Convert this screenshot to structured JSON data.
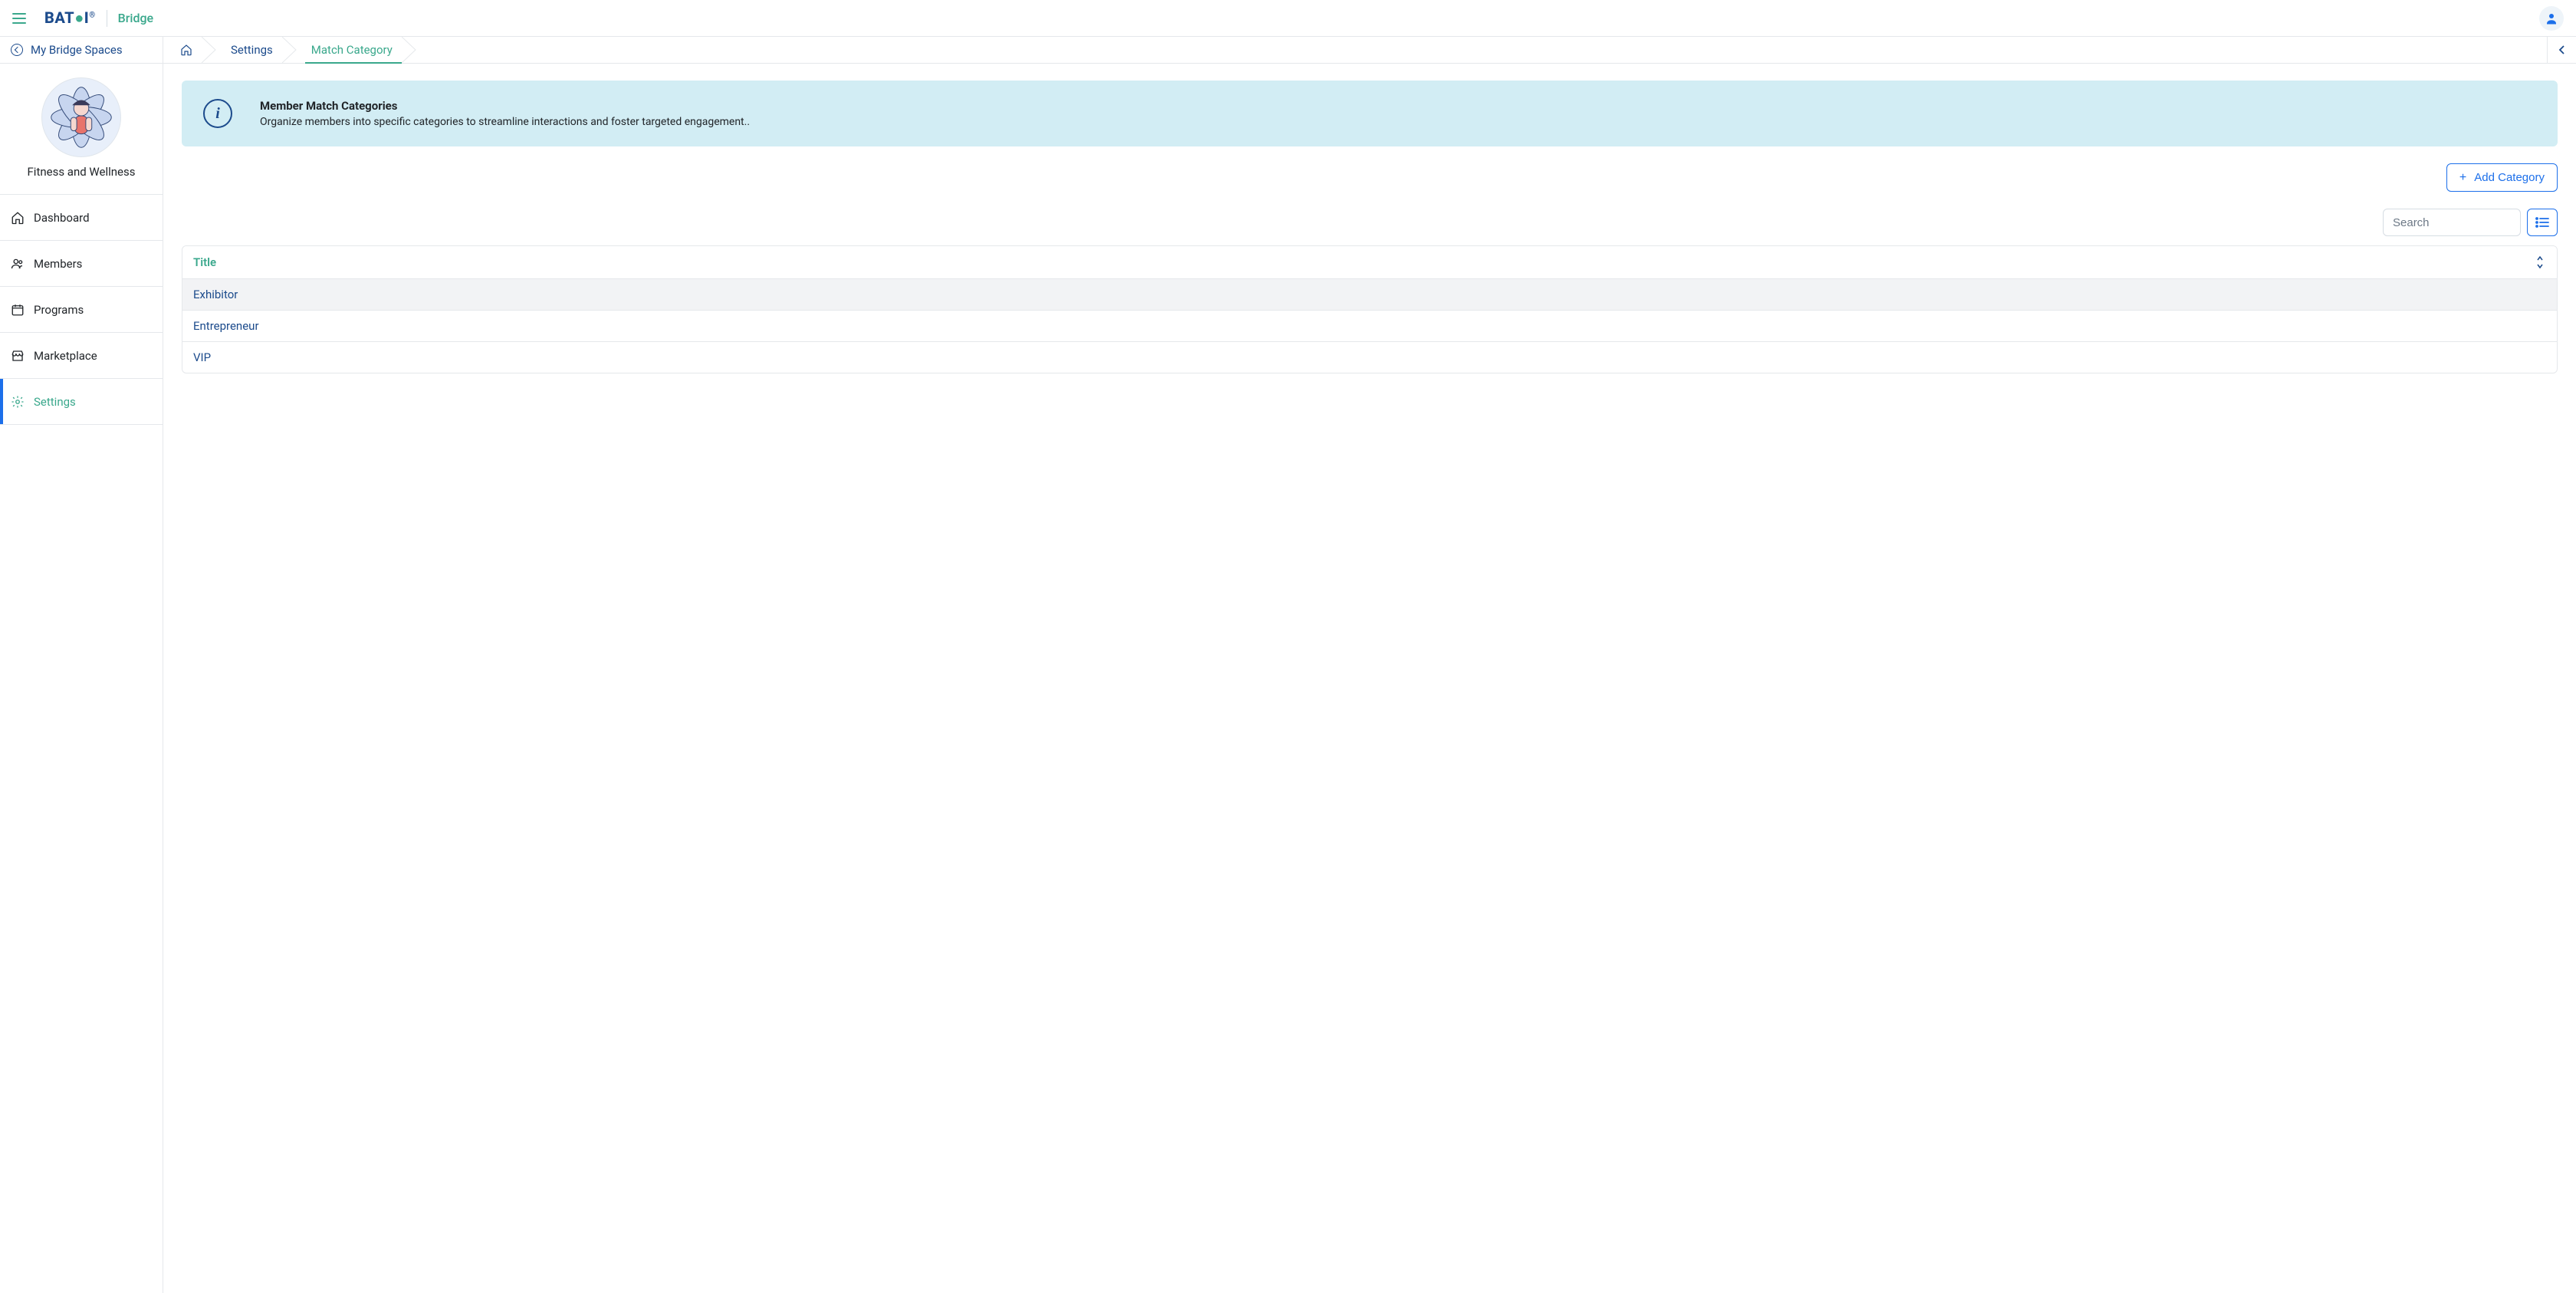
{
  "brand": {
    "logo_text_pre": "BAT",
    "logo_text_post": "I",
    "product": "Bridge"
  },
  "sidebar": {
    "back_label": "My Bridge Spaces",
    "workspace_name": "Fitness and Wellness",
    "items": [
      {
        "label": "Dashboard",
        "icon": "home-icon"
      },
      {
        "label": "Members",
        "icon": "members-icon"
      },
      {
        "label": "Programs",
        "icon": "calendar-icon"
      },
      {
        "label": "Marketplace",
        "icon": "store-icon"
      },
      {
        "label": "Settings",
        "icon": "gear-icon"
      }
    ],
    "active_index": 4
  },
  "breadcrumb": {
    "items": [
      {
        "label": "",
        "is_home": true
      },
      {
        "label": "Settings"
      },
      {
        "label": "Match Category"
      }
    ],
    "active_index": 2
  },
  "banner": {
    "title": "Member Match Categories",
    "description": "Organize members into specific categories to streamline interactions and foster targeted engagement.."
  },
  "actions": {
    "add_category": "Add Category"
  },
  "search": {
    "placeholder": "Search",
    "value": ""
  },
  "table": {
    "columns": [
      "Title"
    ],
    "rows": [
      {
        "title": "Exhibitor"
      },
      {
        "title": "Entrepreneur"
      },
      {
        "title": "VIP"
      }
    ]
  },
  "colors": {
    "accent_green": "#3aa88c",
    "accent_blue": "#1c6fea",
    "text_blue": "#1c4b8c",
    "banner_bg": "#d2edf4"
  }
}
